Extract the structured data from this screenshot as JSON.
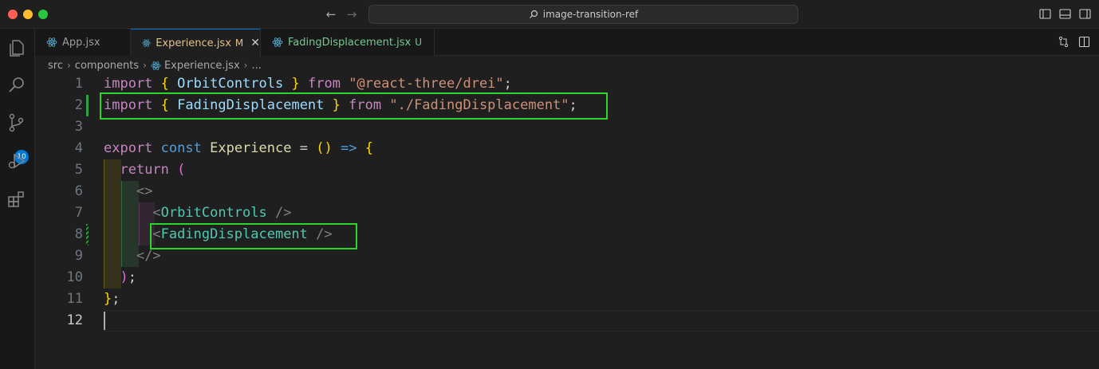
{
  "window": {
    "search_text": "image-transition-ref"
  },
  "tabs": [
    {
      "label": "App.jsx",
      "status": ""
    },
    {
      "label": "Experience.jsx",
      "status": "M"
    },
    {
      "label": "FadingDisplacement.jsx",
      "status": "U"
    }
  ],
  "activity": {
    "scm_badge": "10"
  },
  "breadcrumb": [
    "src",
    "components",
    "Experience.jsx",
    "..."
  ],
  "editor": {
    "line_numbers": [
      "1",
      "2",
      "3",
      "4",
      "5",
      "6",
      "7",
      "8",
      "9",
      "10",
      "11",
      "12"
    ],
    "code": {
      "l1": {
        "t1": "import",
        "t2": "{",
        "t3": "OrbitControls",
        "t4": "}",
        "t5": "from",
        "t6": "\"@react-three/drei\"",
        "t7": ";"
      },
      "l2": {
        "t1": "import",
        "t2": "{",
        "t3": "FadingDisplacement",
        "t4": "}",
        "t5": "from",
        "t6": "\"./FadingDisplacement\"",
        "t7": ";"
      },
      "l4": {
        "t1": "export",
        "t2": "const",
        "t3": "Experience",
        "t4": "=",
        "t5": "()",
        "t6": "=>",
        "t7": "{"
      },
      "l5": {
        "t1": "return",
        "t2": "("
      },
      "l6": {
        "t1": "<>"
      },
      "l7": {
        "t1": "<",
        "t2": "OrbitControls",
        "t3": "/>"
      },
      "l8": {
        "t1": "<",
        "t2": "FadingDisplacement",
        "t3": "/>"
      },
      "l9": {
        "t1": "</>"
      },
      "l10": {
        "t1": ")",
        "t2": ";"
      },
      "l11": {
        "t1": "}",
        "t2": ";"
      }
    }
  },
  "colors": {
    "highlight_box": "#2bd52b",
    "accent": "#0078d4"
  }
}
